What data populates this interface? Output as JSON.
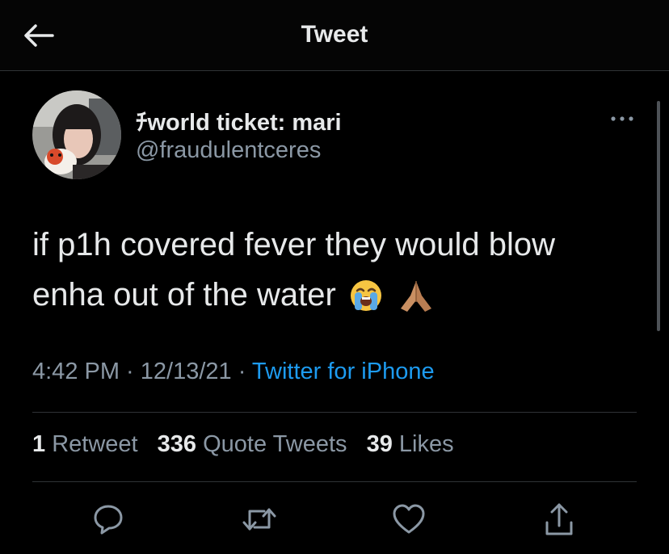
{
  "header": {
    "title": "Tweet",
    "back_icon": "arrow-left-icon"
  },
  "user": {
    "display_name": "ﾁworld ticket: mari",
    "handle": "@fraudulentceres"
  },
  "tweet": {
    "text": "if p1h covered fever they would blow enha out of the water",
    "emojis": [
      "loudly-crying-face",
      "folded-hands"
    ]
  },
  "meta": {
    "time": "4:42 PM",
    "sep1": " · ",
    "date": "12/13/21",
    "sep2": " · ",
    "source": "Twitter for iPhone"
  },
  "stats": {
    "retweets": {
      "count": "1",
      "label": "Retweet"
    },
    "quotes": {
      "count": "336",
      "label": "Quote Tweets"
    },
    "likes": {
      "count": "39",
      "label": "Likes"
    }
  },
  "actions": [
    "reply-icon",
    "retweet-icon",
    "like-icon",
    "share-icon"
  ],
  "colors": {
    "background": "#000000",
    "text": "#e7e9ea",
    "muted": "#8b98a5",
    "link": "#1d9bf0",
    "divider": "#2f3336"
  }
}
